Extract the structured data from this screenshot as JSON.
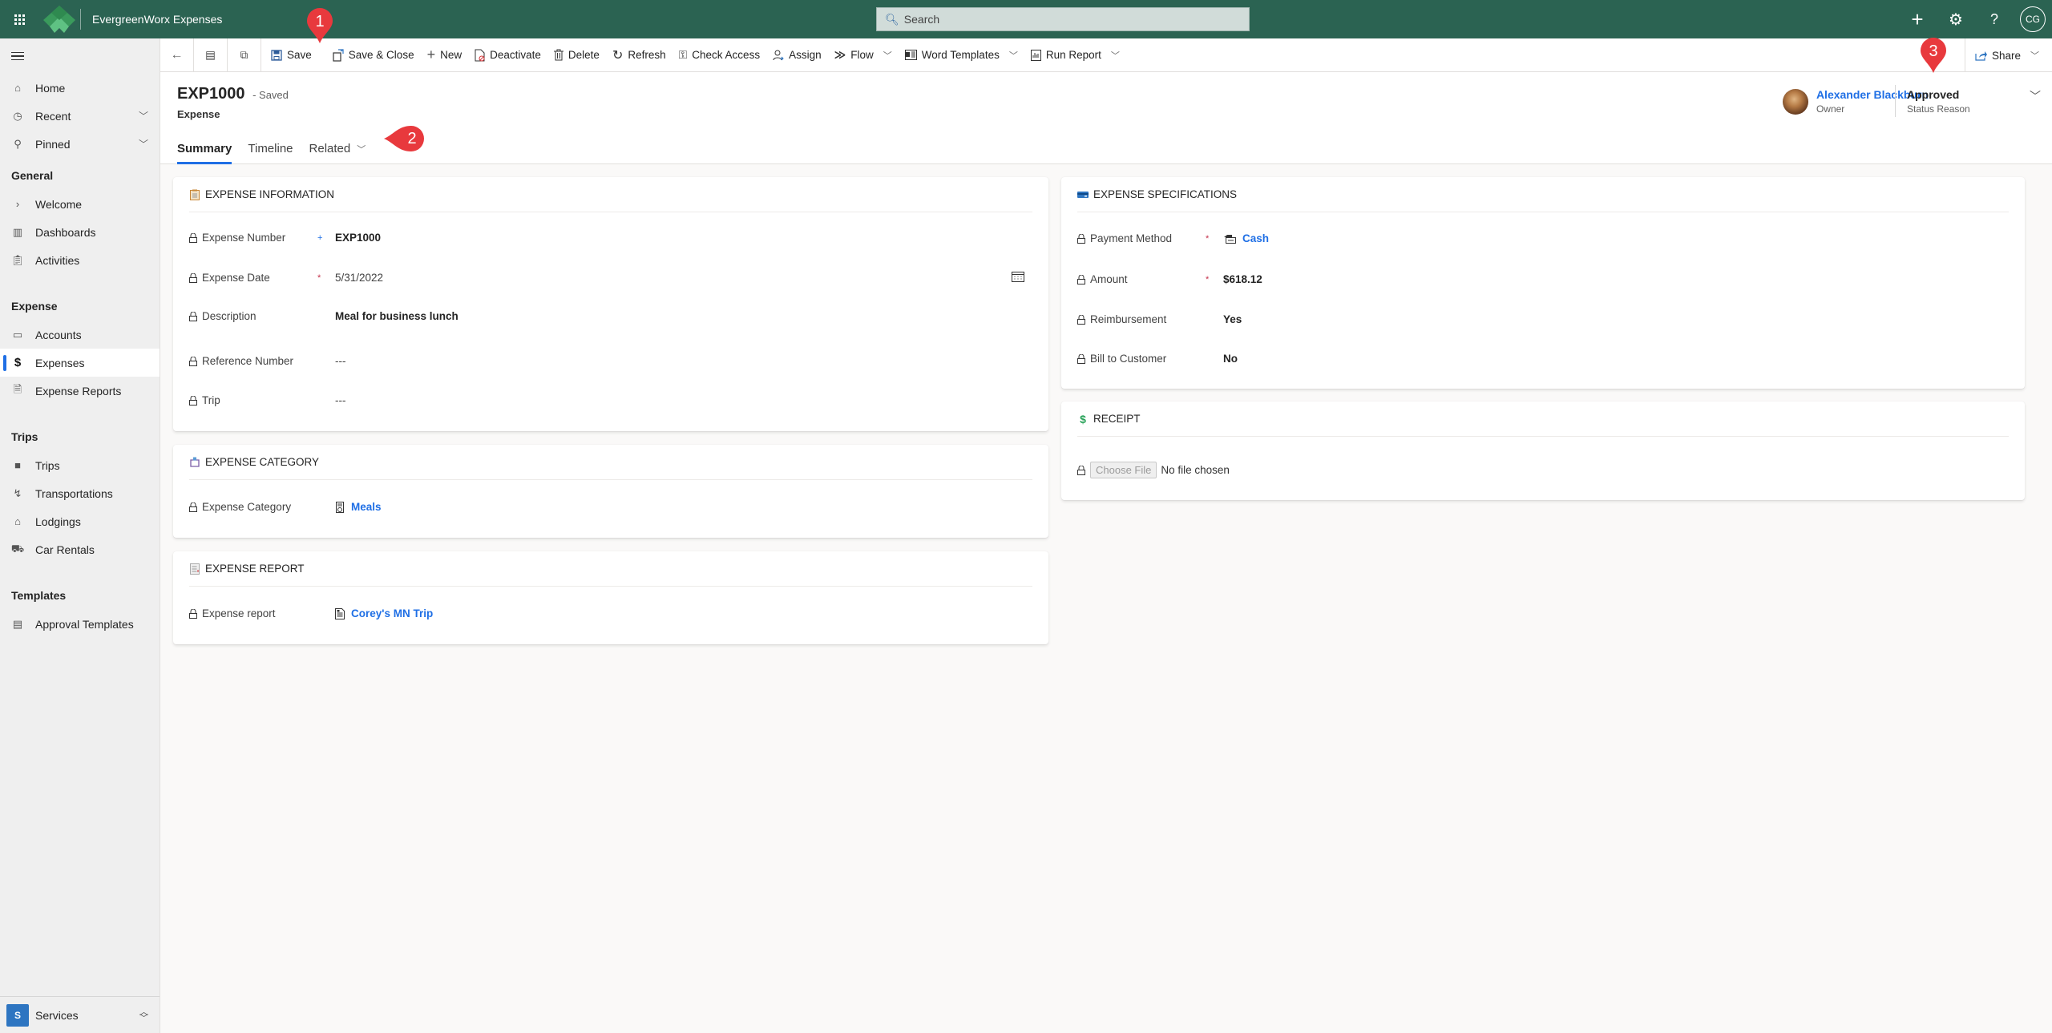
{
  "app": {
    "title": "EvergreenWorx Expenses",
    "search_placeholder": "Search",
    "user_initials": "CG",
    "brand_color": "#2b6352",
    "accent_color": "#1f6fe5"
  },
  "sidebar": {
    "top_items": [
      {
        "label": "Home",
        "icon": "home-icon"
      },
      {
        "label": "Recent",
        "icon": "clock-icon",
        "expandable": true
      },
      {
        "label": "Pinned",
        "icon": "pin-icon",
        "expandable": true
      }
    ],
    "groups": [
      {
        "title": "General",
        "items": [
          {
            "label": "Welcome",
            "icon": "chevron-right-icon"
          },
          {
            "label": "Dashboards",
            "icon": "dashboard-icon"
          },
          {
            "label": "Activities",
            "icon": "clipboard-icon"
          }
        ]
      },
      {
        "title": "Expense",
        "items": [
          {
            "label": "Accounts",
            "icon": "account-icon"
          },
          {
            "label": "Expenses",
            "icon": "dollar-icon",
            "active": true
          },
          {
            "label": "Expense Reports",
            "icon": "report-icon"
          }
        ]
      },
      {
        "title": "Trips",
        "items": [
          {
            "label": "Trips",
            "icon": "suitcase-icon"
          },
          {
            "label": "Transportations",
            "icon": "route-icon"
          },
          {
            "label": "Lodgings",
            "icon": "lodging-icon"
          },
          {
            "label": "Car Rentals",
            "icon": "car-icon"
          }
        ]
      },
      {
        "title": "Templates",
        "items": [
          {
            "label": "Approval Templates",
            "icon": "approval-icon"
          }
        ]
      }
    ],
    "area": {
      "badge": "S",
      "label": "Services"
    }
  },
  "commandbar": {
    "items": [
      {
        "label": "Save",
        "icon": "save-icon"
      },
      {
        "label": "Save & Close",
        "icon": "save-close-icon"
      },
      {
        "label": "New",
        "icon": "plus-icon"
      },
      {
        "label": "Deactivate",
        "icon": "deactivate-icon"
      },
      {
        "label": "Delete",
        "icon": "delete-icon"
      },
      {
        "label": "Refresh",
        "icon": "refresh-icon"
      },
      {
        "label": "Check Access",
        "icon": "key-icon"
      },
      {
        "label": "Assign",
        "icon": "assign-icon"
      },
      {
        "label": "Flow",
        "icon": "flow-icon",
        "dropdown": true
      },
      {
        "label": "Word Templates",
        "icon": "word-icon",
        "dropdown": true
      },
      {
        "label": "Run Report",
        "icon": "report-icon",
        "dropdown": true
      }
    ],
    "share": "Share"
  },
  "record": {
    "title": "EXP1000",
    "save_state": "- Saved",
    "entity": "Expense",
    "tabs": [
      {
        "label": "Summary",
        "active": true
      },
      {
        "label": "Timeline"
      },
      {
        "label": "Related",
        "dropdown": true
      }
    ],
    "owner": {
      "name": "Alexander Blackburn",
      "role": "Owner"
    },
    "status": {
      "value": "Approved",
      "label": "Status Reason"
    }
  },
  "sections": {
    "expense_information": {
      "title": "EXPENSE INFORMATION",
      "fields": [
        {
          "label": "Expense Number",
          "value": "EXP1000",
          "required": "recommended"
        },
        {
          "label": "Expense Date",
          "value": "5/31/2022",
          "required": "required"
        },
        {
          "label": "Description",
          "value": "Meal for business lunch"
        },
        {
          "label": "Reference Number",
          "value": "---"
        },
        {
          "label": "Trip",
          "value": "---"
        }
      ]
    },
    "expense_category": {
      "title": "EXPENSE CATEGORY",
      "fields": [
        {
          "label": "Expense Category",
          "value": "Meals",
          "link": true
        }
      ]
    },
    "expense_report": {
      "title": "EXPENSE REPORT",
      "fields": [
        {
          "label": "Expense report",
          "value": "Corey's MN Trip",
          "link": true
        }
      ]
    },
    "expense_specifications": {
      "title": "EXPENSE SPECIFICATIONS",
      "fields": [
        {
          "label": "Payment Method",
          "value": "Cash",
          "required": "required",
          "link": true
        },
        {
          "label": "Amount",
          "value": "$618.12",
          "required": "required"
        },
        {
          "label": "Reimbursement",
          "value": "Yes"
        },
        {
          "label": "Bill to Customer",
          "value": "No"
        }
      ]
    },
    "receipt": {
      "title": "RECEIPT",
      "choose_file": "Choose File",
      "no_file": "No file chosen"
    }
  },
  "callouts": [
    "1",
    "2",
    "3"
  ],
  "required_marker": "*",
  "recommended_marker": "+"
}
